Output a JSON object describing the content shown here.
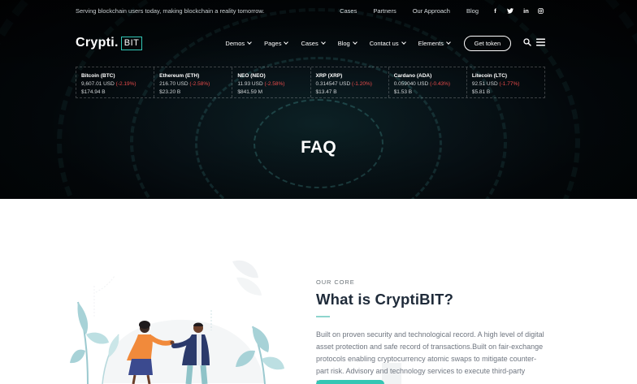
{
  "topbar": {
    "tagline": "Serving blockchain users today, making blockchain a reality tomorrow.",
    "links": [
      "Cases",
      "Partners",
      "Our Approach",
      "Blog"
    ],
    "social_icons": [
      "facebook-icon",
      "twitter-icon",
      "linkedin-icon",
      "instagram-icon"
    ],
    "facebook_glyph": "f",
    "linkedin_glyph": "in"
  },
  "logo": {
    "main": "Crypti.",
    "box": "BIT",
    "accent_color": "#33c6b6"
  },
  "nav": {
    "items": [
      "Demos",
      "Pages",
      "Cases",
      "Blog",
      "Contact us",
      "Elements"
    ],
    "cta": "Get token"
  },
  "ticker": [
    {
      "name": "Bitcoin (BTC)",
      "price": "9,607.01 USD",
      "change": "(-2.19%)",
      "cap": "$174.94 B"
    },
    {
      "name": "Ethereum (ETH)",
      "price": "216.70 USD",
      "change": "(-2.58%)",
      "cap": "$23.20 B"
    },
    {
      "name": "NEO (NEO)",
      "price": "11.93 USD",
      "change": "(-2.58%)",
      "cap": "$841.59 M"
    },
    {
      "name": "XRP (XRP)",
      "price": "0.314547 USD",
      "change": "(-1.20%)",
      "cap": "$13.47 B"
    },
    {
      "name": "Cardano (ADA)",
      "price": "0.059040 USD",
      "change": "(-0.43%)",
      "cap": "$1.53 B"
    },
    {
      "name": "Litecoin (LTC)",
      "price": "92.51 USD",
      "change": "(-1.77%)",
      "cap": "$5.81 B"
    }
  ],
  "page_title": "FAQ",
  "section": {
    "eyebrow": "OUR CORE",
    "title": "What is CryptiBIT?",
    "body": "Built on proven security and technological record. A high level of digital asset protection and safe record of transactions.Built on fair-exchange protocols enabling cryptocurrency atomic swaps to mitigate counter-part risk. Advisory and technology services to execute third-party ICOs."
  },
  "colors": {
    "accent": "#33c6b6",
    "negative": "#ea4b4b",
    "heading": "#1f2b3a"
  }
}
